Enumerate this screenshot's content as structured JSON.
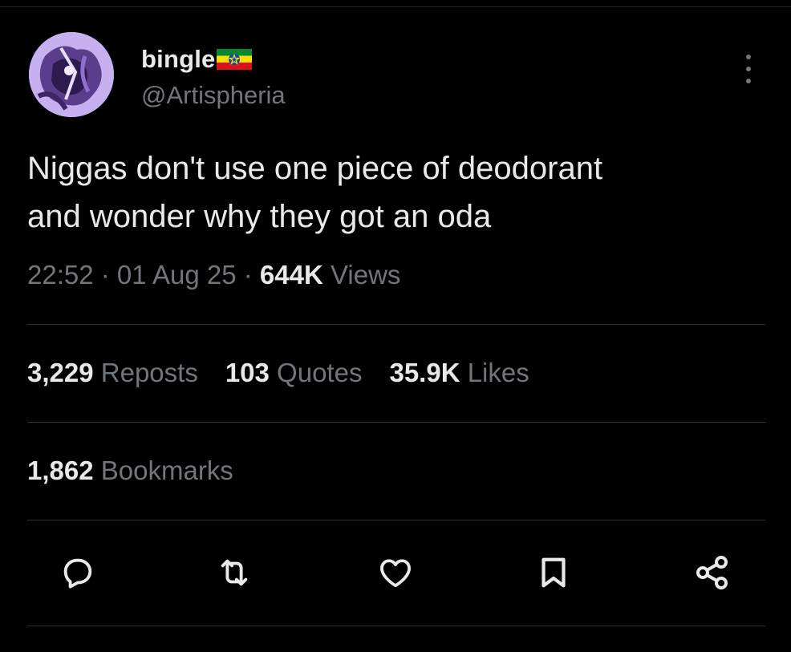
{
  "tweet": {
    "author": {
      "display_name": "bingle",
      "handle": "@Artispheria",
      "flag": "ethiopia-flag"
    },
    "text": "Niggas don't use one piece of deodorant\nand wonder why they got an oda",
    "meta": {
      "time": "22:52",
      "separator1": " · ",
      "date": "01 Aug 25",
      "separator2": " · ",
      "views_count": "644K",
      "views_label": " Views"
    },
    "stats": {
      "reposts_count": "3,229",
      "reposts_label": " Reposts",
      "quotes_count": "103",
      "quotes_label": " Quotes",
      "likes_count": "35.9K",
      "likes_label": " Likes",
      "bookmarks_count": "1,862",
      "bookmarks_label": " Bookmarks"
    },
    "actions": [
      "reply-icon",
      "repost-icon",
      "like-icon",
      "bookmark-icon",
      "share-icon"
    ]
  },
  "colors": {
    "background": "#000000",
    "primary_text": "#e7e9ea",
    "secondary_text": "#71767b",
    "divider": "#2f3336",
    "avatar_tint": "#b79be6"
  }
}
